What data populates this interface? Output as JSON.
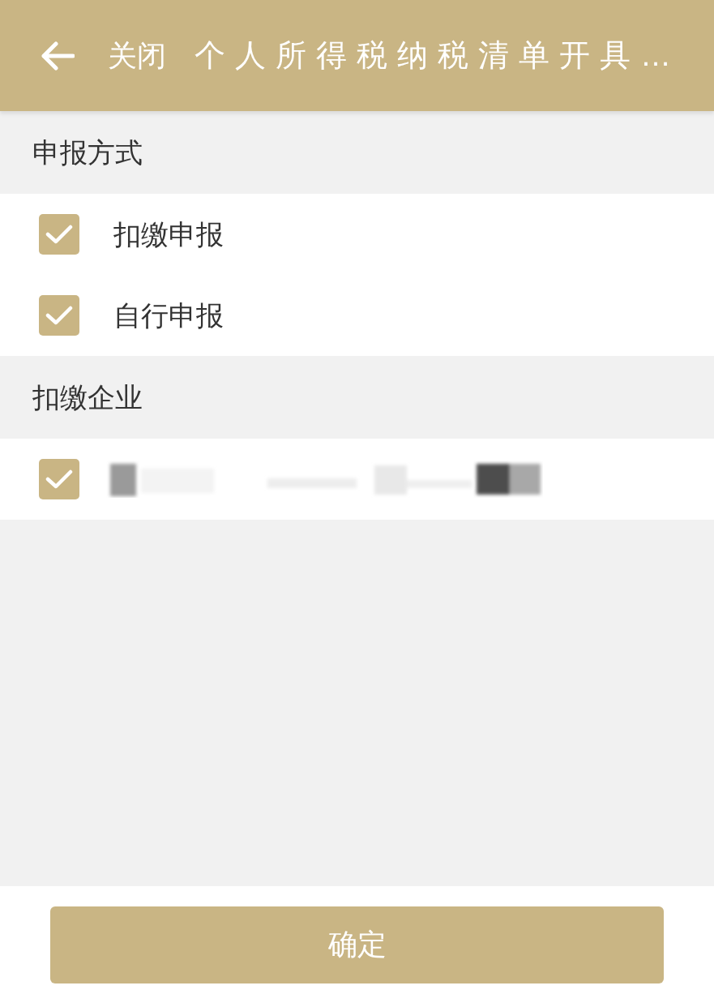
{
  "header": {
    "close_label": "关闭",
    "title": "个人所得税纳税清单开具…"
  },
  "sections": [
    {
      "title": "申报方式",
      "options": [
        {
          "kind": "text",
          "label": "扣缴申报",
          "checked": true
        },
        {
          "kind": "text",
          "label": "自行申报",
          "checked": true
        }
      ]
    },
    {
      "title": "扣缴企业",
      "options": [
        {
          "kind": "redacted",
          "checked": true
        }
      ]
    }
  ],
  "confirm_button": "确定"
}
